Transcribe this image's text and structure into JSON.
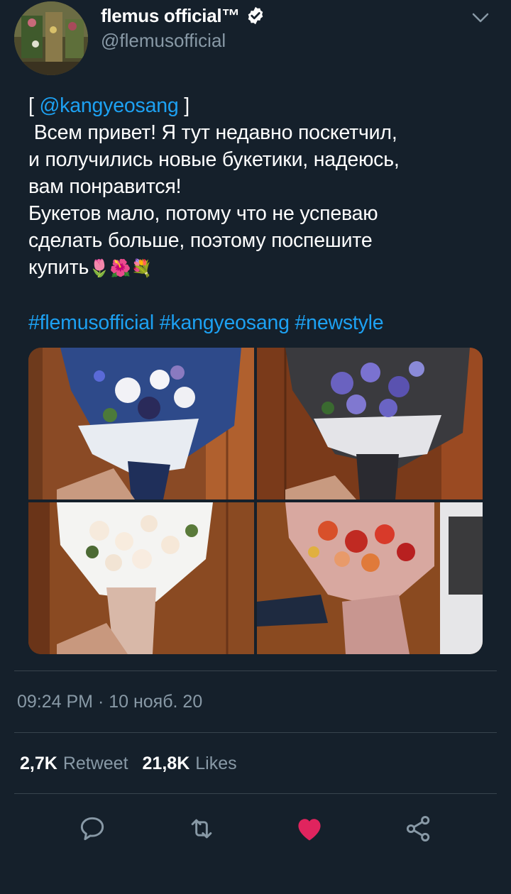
{
  "tweet": {
    "display_name": "flemus official™",
    "handle": "@flemusofficial",
    "mention": "@kangyeosang",
    "bracket_open": "[ ",
    "bracket_close": " ]",
    "body_lines": [
      " Всем привет! Я тут недавно поскетчил,",
      "и получились новые букетики, надеюсь,",
      "вам понравится!",
      "Букетов мало, потому что не успеваю",
      "сделать больше, поэтому поспешите",
      "купить"
    ],
    "emojis": "🌷🌺💐",
    "hashtags": [
      "#flemusofficial",
      "#kangyeosang",
      "#newstyle"
    ],
    "timestamp": "09:24 PM · 10 нояб. 20"
  },
  "stats": {
    "retweets_count": "2,7K",
    "retweets_label": "Retweet",
    "likes_count": "21,8K",
    "likes_label": "Likes"
  },
  "icons": {
    "verified": "verified-badge-icon",
    "menu": "chevron-down-icon",
    "reply": "reply-icon",
    "retweet": "retweet-icon",
    "like": "heart-icon",
    "share": "share-icon"
  },
  "colors": {
    "background": "#15202b",
    "link": "#1da1f2",
    "secondary_text": "#8899a6",
    "like_active": "#e0245e"
  }
}
